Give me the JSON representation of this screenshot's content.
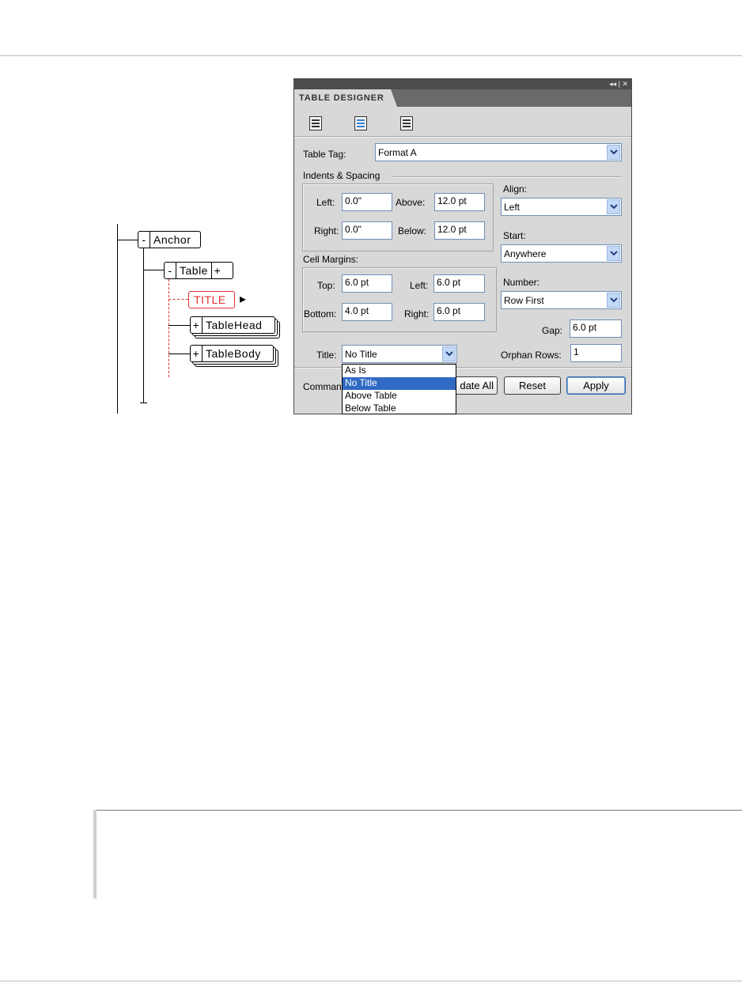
{
  "tree": {
    "anchor": {
      "minus": "-",
      "label": "Anchor"
    },
    "table": {
      "minus": "-",
      "label": "Table",
      "plus": "+"
    },
    "title": {
      "label": "TITLE",
      "arrow": "▸"
    },
    "tablehead": {
      "plus": "+",
      "label": "TableHead"
    },
    "tablebody": {
      "plus": "+",
      "label": "TableBody"
    }
  },
  "panel": {
    "controls": "◂◂ | ✕",
    "tab": "TABLE DESIGNER",
    "toolbar_icons": [
      "table-properties-icon",
      "table-header-icon",
      "table-body-icon"
    ],
    "table_tag_label": "Table Tag:",
    "table_tag_value": "Format A",
    "indents_label": "Indents & Spacing",
    "left_label": "Left:",
    "left_value": "0.0\"",
    "above_label": "Above:",
    "above_value": "12.0 pt",
    "right_label": "Right:",
    "right_value": "0.0\"",
    "below_label": "Below:",
    "below_value": "12.0 pt",
    "align_label": "Align:",
    "align_value": "Left",
    "start_label": "Start:",
    "start_value": "Anywhere",
    "cell_margins_label": "Cell Margins:",
    "top_label": "Top:",
    "top_value": "6.0 pt",
    "cm_left_label": "Left:",
    "cm_left_value": "6.0 pt",
    "bottom_label": "Bottom:",
    "bottom_value": "4.0 pt",
    "cm_right_label": "Right:",
    "cm_right_value": "6.0 pt",
    "number_label": "Number:",
    "number_value": "Row First",
    "gap_label": "Gap:",
    "gap_value": "6.0 pt",
    "title_label": "Title:",
    "title_value": "No Title",
    "orphan_label": "Orphan Rows:",
    "orphan_value": "1",
    "commands_label": "Comman",
    "update_all": "date All",
    "reset": "Reset",
    "apply": "Apply",
    "title_options": [
      "As Is",
      "No Title",
      "Above Table",
      "Below Table"
    ],
    "title_selected_index": 1
  },
  "colors": {
    "accent_selection": "#316ac5",
    "title_node": "#e03030"
  }
}
